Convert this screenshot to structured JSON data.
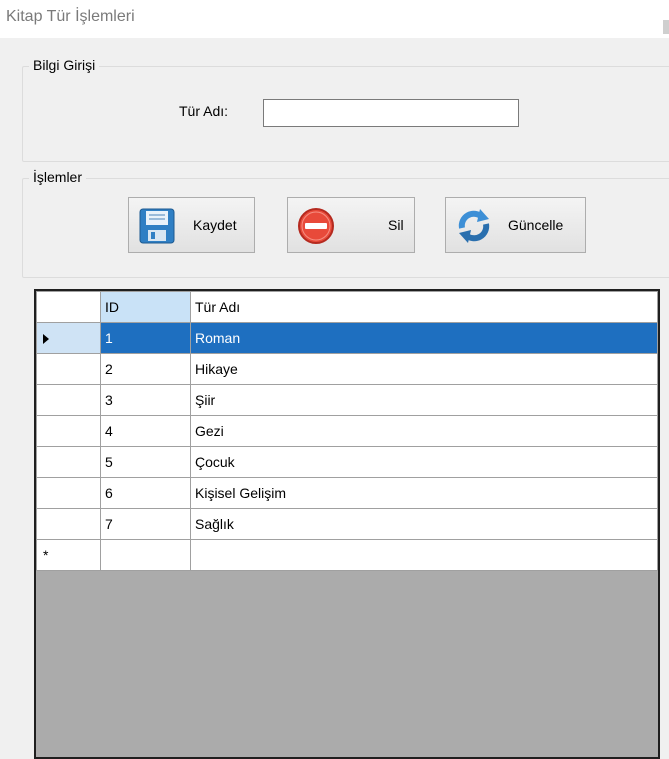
{
  "window": {
    "title": "Kitap Tür İşlemleri"
  },
  "info_group": {
    "legend": "Bilgi Girişi",
    "name_label": "Tür Adı:",
    "name_value": "",
    "name_placeholder": ""
  },
  "ops_group": {
    "legend": "İşlemler",
    "buttons": [
      {
        "label": "Kaydet",
        "icon": "floppy-disk-icon"
      },
      {
        "label": "Sil",
        "icon": "delete-stop-icon"
      },
      {
        "label": "Güncelle",
        "icon": "refresh-arrows-icon"
      }
    ]
  },
  "grid": {
    "columns": [
      "ID",
      "Tür Adı"
    ],
    "rows": [
      {
        "id": "1",
        "name": "Roman"
      },
      {
        "id": "2",
        "name": "Hikaye"
      },
      {
        "id": "3",
        "name": "Şiir"
      },
      {
        "id": "4",
        "name": "Gezi"
      },
      {
        "id": "5",
        "name": "Çocuk"
      },
      {
        "id": "6",
        "name": "Kişisel Gelişim"
      },
      {
        "id": "7",
        "name": "Sağlık"
      }
    ],
    "selected_row_index": 0,
    "current_row_glyph": "▶",
    "new_row_glyph": "*",
    "colors": {
      "selection": "#1e6fc0",
      "empty_area": "#ababab"
    }
  }
}
